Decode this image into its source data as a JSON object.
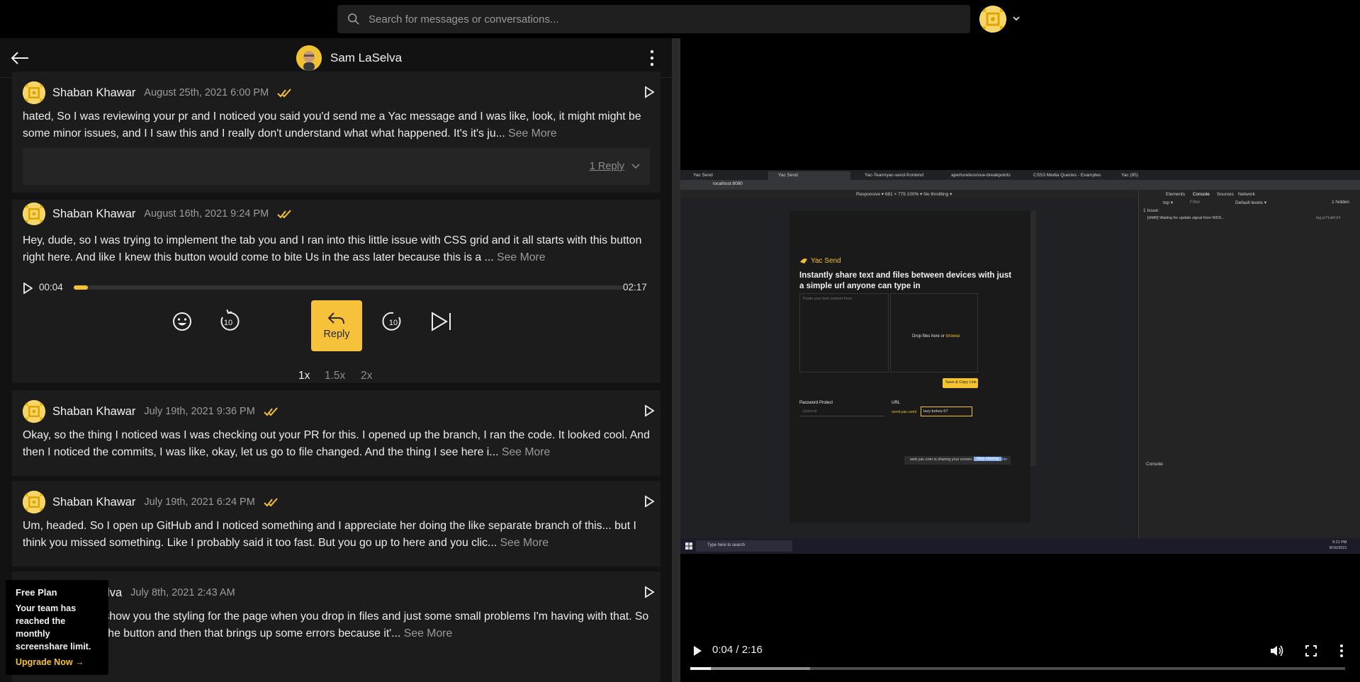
{
  "search": {
    "placeholder": "Search for messages or conversations..."
  },
  "conversation": {
    "name": "Sam LaSelva"
  },
  "messages": [
    {
      "author": "Shaban Khawar",
      "date": "August 25th, 2021 6:00 PM",
      "text": "hated, So I was reviewing your pr and I noticed you said you'd send me a Yac message and I was like, look, it might might be some minor issues, and I I saw this and I really don't understand what what happened. It's it's ju...",
      "see_more": "See More",
      "reply_label": "1 Reply"
    },
    {
      "author": "Shaban Khawar",
      "date": "August 16th, 2021 9:24 PM",
      "text": "Hey, dude, so I was trying to implement the tab you and I ran into this little issue with CSS grid and it all starts with this button right here. And like I knew this button would come to bite Us in the ass later because this is a ...",
      "see_more": "See More"
    },
    {
      "author": "Shaban Khawar",
      "date": "July 19th, 2021 9:36 PM",
      "text": "Okay, so the thing I noticed was I was checking out your PR for this. I opened up the branch, I ran the code. It looked cool. And then I noticed the commits, I was like, okay, let us go to file changed. And the thing I see here i...",
      "see_more": "See More"
    },
    {
      "author": "Shaban Khawar",
      "date": "July 19th, 2021 6:24 PM",
      "text": "Um, headed. So I open up GitHub and I noticed something and I appreciate her doing the like separate branch of this... but I think you missed something. Like I probably said it too fast. But you go up to here and you clic...",
      "see_more": "See More"
    },
    {
      "author": "Sam LaSelva",
      "date": "July 8th, 2021 2:43 AM",
      "text": "I'm just going to show you the styling for the page when you drop in files and just some small problems I'm having with that. So you see, I move the button and then that brings up some errors because it'...",
      "see_more": "See More"
    }
  ],
  "player": {
    "current": "00:04",
    "duration": "02:17",
    "progress": 0.026,
    "reply_label": "Reply",
    "speeds": [
      "1x",
      "1.5x",
      "2x"
    ],
    "active_speed": "1x",
    "accent": "#f5c230"
  },
  "free_plan": {
    "title": "Free Plan",
    "body": "Your team has reached the monthly screenshare limit.",
    "link": "Upgrade Now →"
  },
  "video": {
    "time": "0:04 / 2:16",
    "progress": 0.031,
    "buffered": 0.183,
    "browser": {
      "tabs": [
        "Yac Send",
        "Yac Send",
        "Yac-Team/yac-send-frontend",
        "apertureless/vue-breakpoints",
        "CSS3 Media Queries - Examples",
        "Yac (85)"
      ],
      "url": "localhost:8080",
      "devbar": "Responsive ▾   681  ×  775   100% ▾   No throttling ▾",
      "devtools_tabs": [
        "Elements",
        "Console",
        "Sources",
        "Network"
      ],
      "console_msg": "[HMR] Waiting for update signal from WDS...",
      "console_src": "log.js?1afd:24",
      "issues": "1 Issue:",
      "console_label": "Console",
      "filter": "Filter",
      "levels": "Default levels ▾",
      "top": "top ▾",
      "hidden": "1 hidden",
      "app_title": "Yac Send",
      "app_heading": "Instantly share text and files between devices with just a simple url anyone can type in",
      "textarea_placeholder": "Paste your text content here",
      "drop_text": "Drop files here or",
      "drop_link": "browse",
      "save_btn": "Save & Copy Link",
      "password_label": "Password Protect",
      "password_placeholder": "Optional",
      "url_label": "URL",
      "url_prefix": "send.yac.com/",
      "url_value": "lazy-turkey-57",
      "sharing_text": "web.yac.com is sharing your screen.",
      "stop_sharing": "Stop sharing",
      "hide": "Hide",
      "taskbar_search": "Type here to search",
      "clock_time": "9:21 PM",
      "clock_date": "8/16/2021"
    }
  }
}
